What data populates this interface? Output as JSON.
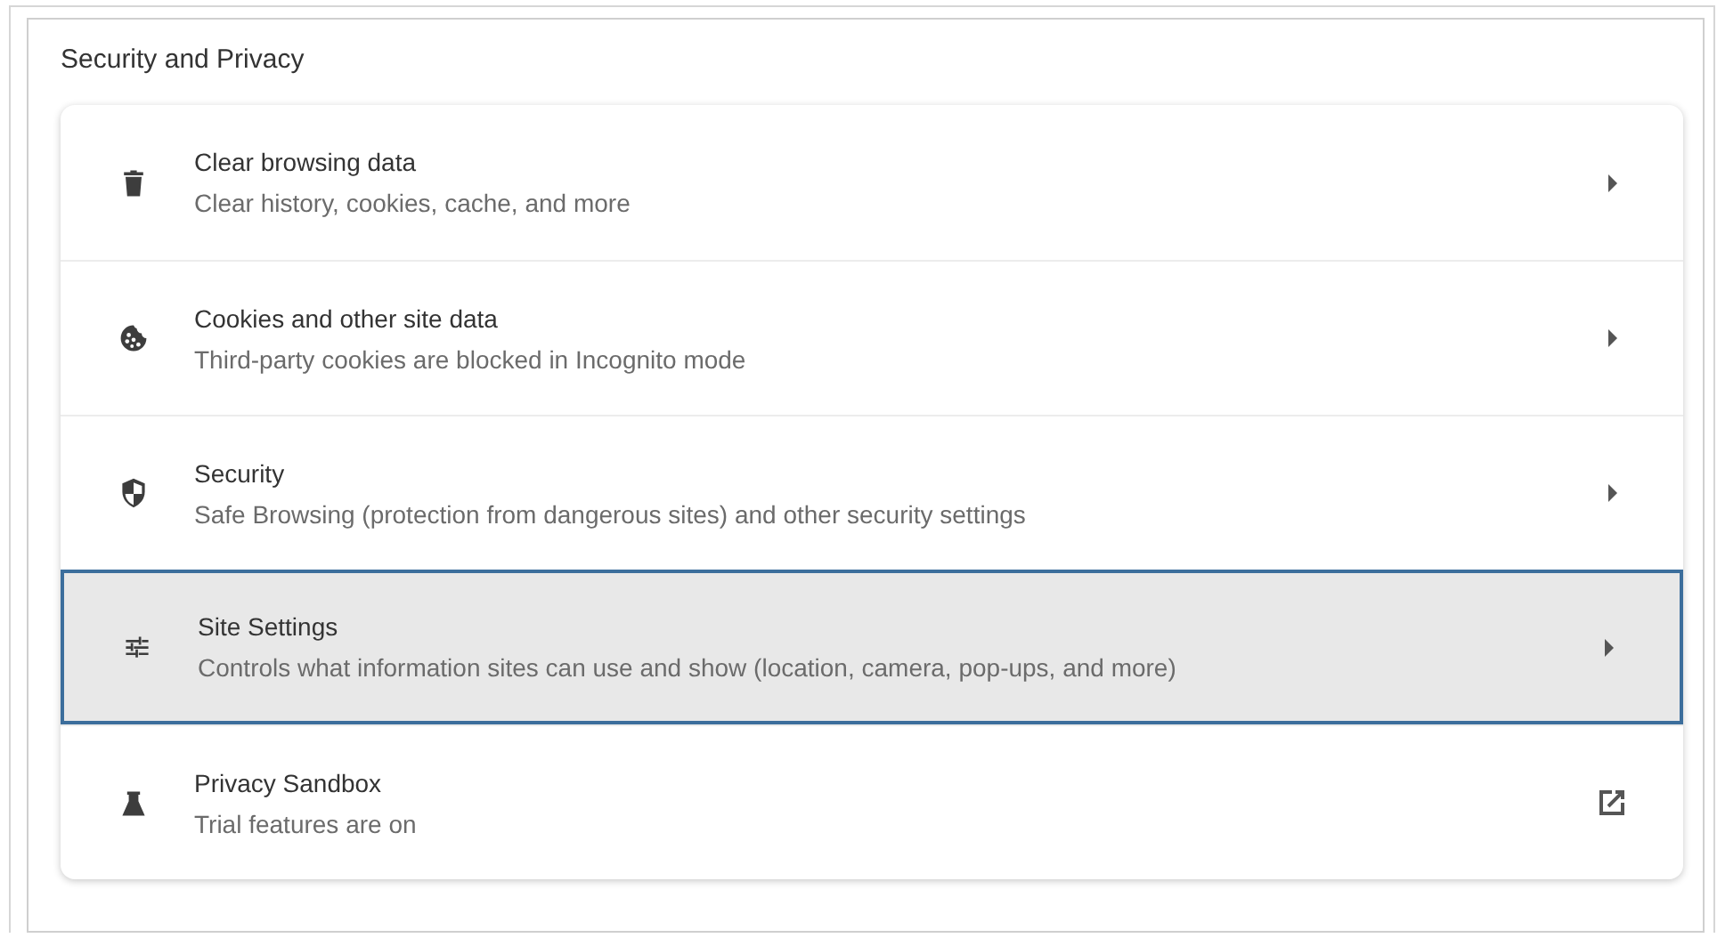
{
  "section": {
    "title": "Security and Privacy"
  },
  "items": [
    {
      "title": "Clear browsing data",
      "subtitle": "Clear history, cookies, cache, and more",
      "kind": "submenu",
      "selected": false
    },
    {
      "title": "Cookies and other site data",
      "subtitle": "Third-party cookies are blocked in Incognito mode",
      "kind": "submenu",
      "selected": false
    },
    {
      "title": "Security",
      "subtitle": "Safe Browsing (protection from dangerous sites) and other security settings",
      "kind": "submenu",
      "selected": false
    },
    {
      "title": "Site Settings",
      "subtitle": "Controls what information sites can use and show (location, camera, pop-ups, and more)",
      "kind": "submenu",
      "selected": true
    },
    {
      "title": "Privacy Sandbox",
      "subtitle": "Trial features are on",
      "kind": "external",
      "selected": false
    }
  ]
}
